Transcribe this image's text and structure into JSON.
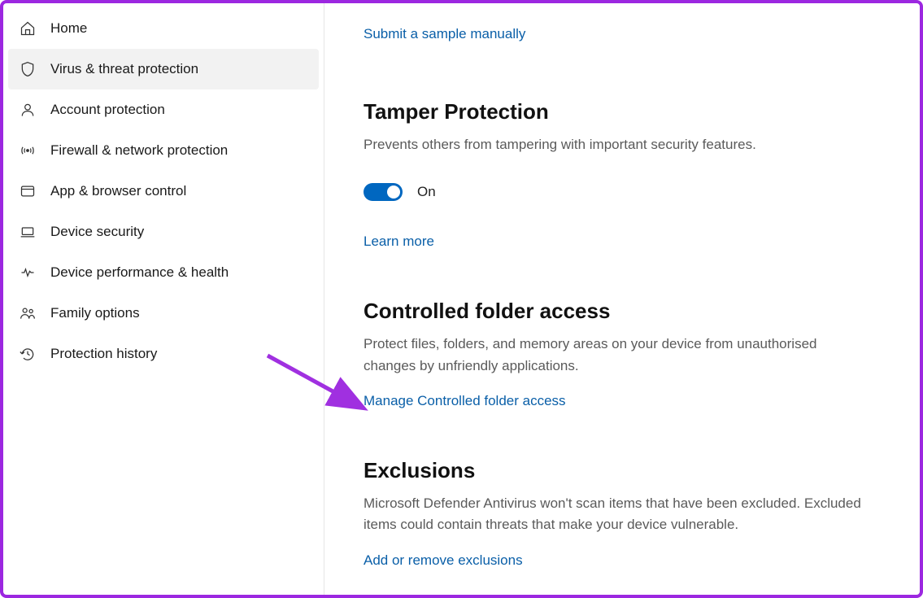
{
  "sidebar": {
    "items": [
      {
        "label": "Home"
      },
      {
        "label": "Virus & threat protection"
      },
      {
        "label": "Account protection"
      },
      {
        "label": "Firewall & network protection"
      },
      {
        "label": "App & browser control"
      },
      {
        "label": "Device security"
      },
      {
        "label": "Device performance & health"
      },
      {
        "label": "Family options"
      },
      {
        "label": "Protection history"
      }
    ]
  },
  "content": {
    "submit_sample_link": "Submit a sample manually",
    "tamper": {
      "title": "Tamper Protection",
      "desc": "Prevents others from tampering with important security features.",
      "toggle_state": "On",
      "learn_more": "Learn more"
    },
    "cfa": {
      "title": "Controlled folder access",
      "desc": "Protect files, folders, and memory areas on your device from unauthorised changes by unfriendly applications.",
      "manage_link": "Manage Controlled folder access"
    },
    "exclusions": {
      "title": "Exclusions",
      "desc": "Microsoft Defender Antivirus won't scan items that have been excluded. Excluded items could contain threats that make your device vulnerable.",
      "add_link": "Add or remove exclusions"
    }
  }
}
